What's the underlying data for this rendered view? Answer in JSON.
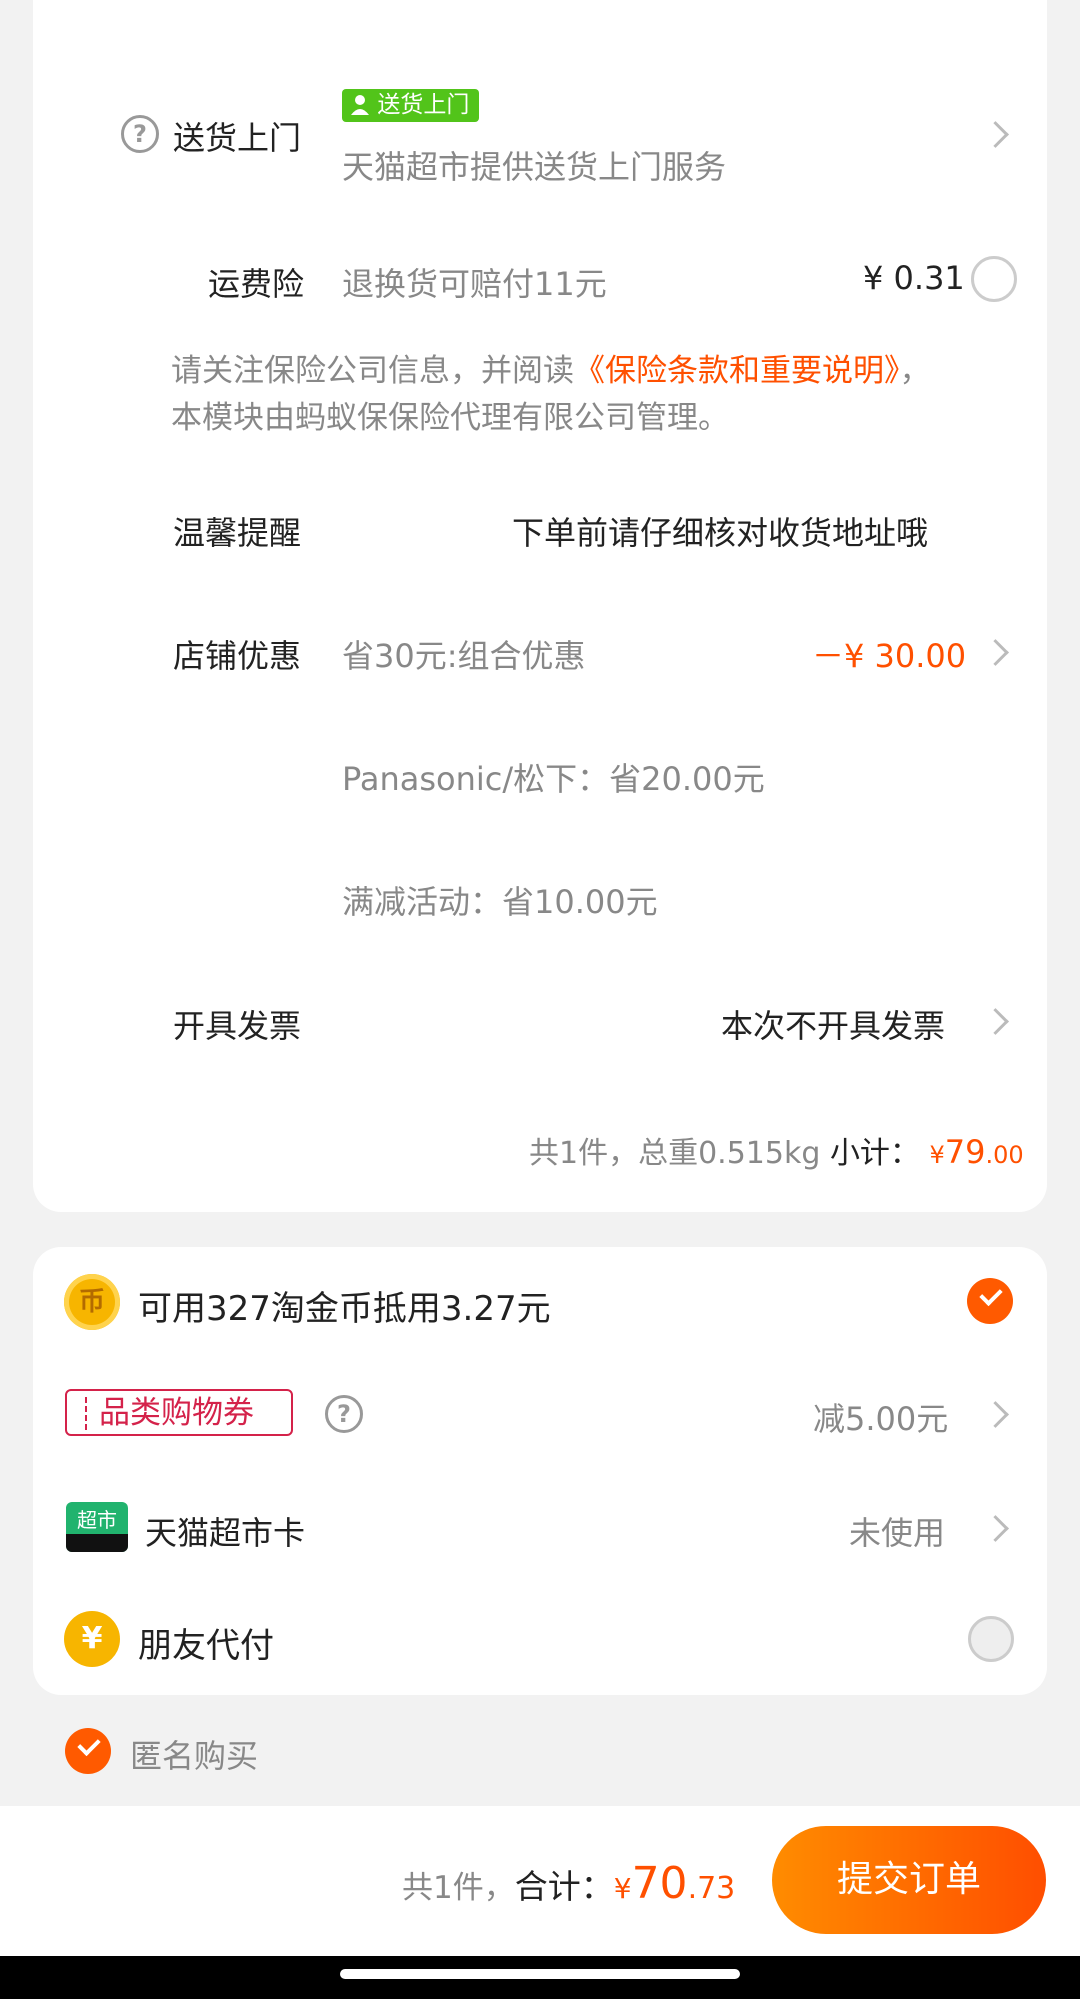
{
  "delivery": {
    "label": "送货上门",
    "badge": "送货上门",
    "desc": "天猫超市提供送货上门服务"
  },
  "shipping_insurance": {
    "label": "运费险",
    "desc": "退换货可赔付11元",
    "price": "¥ 0.31",
    "notice_prefix": "请关注保险公司信息，并阅读",
    "notice_link": "《保险条款和重要说明》",
    "notice_comma": "，",
    "notice_line2": "本模块由蚂蚁保保险代理有限公司管理。"
  },
  "reminder": {
    "label": "温馨提醒",
    "text": "下单前请仔细核对收货地址哦"
  },
  "shop_discount": {
    "label": "店铺优惠",
    "desc": "省30元:组合优惠",
    "amount": "－¥ 30.00",
    "detail1": "Panasonic/松下：省20.00元",
    "detail2": "满减活动：省10.00元"
  },
  "invoice": {
    "label": "开具发票",
    "value": "本次不开具发票"
  },
  "subtotal": {
    "summary": "共1件，总重0.515kg",
    "label": "小计：",
    "currency": "¥",
    "int": "79",
    "dec": ".00"
  },
  "payment_options": {
    "coins": {
      "icon": "币",
      "text": "可用327淘金币抵用3.27元",
      "checked": true
    },
    "coupon": {
      "badge": "品类购物券",
      "value": "减5.00元"
    },
    "supermarket_card": {
      "icon": "超市",
      "label": "天猫超市卡",
      "value": "未使用"
    },
    "friend_pay": {
      "icon": "¥",
      "label": "朋友代付",
      "checked": false
    }
  },
  "anonymous": {
    "label": "匿名购买",
    "checked": true
  },
  "footer": {
    "count": "共1件，",
    "total_label": "合计：",
    "currency": "¥",
    "int": "70",
    "dec": ".73",
    "submit": "提交订单"
  },
  "colors": {
    "accent": "#ff5000",
    "green_badge": "#52c41a",
    "coupon_red": "#d4224a",
    "card_green": "#21b36e",
    "coin_yellow": "#f7b500"
  }
}
